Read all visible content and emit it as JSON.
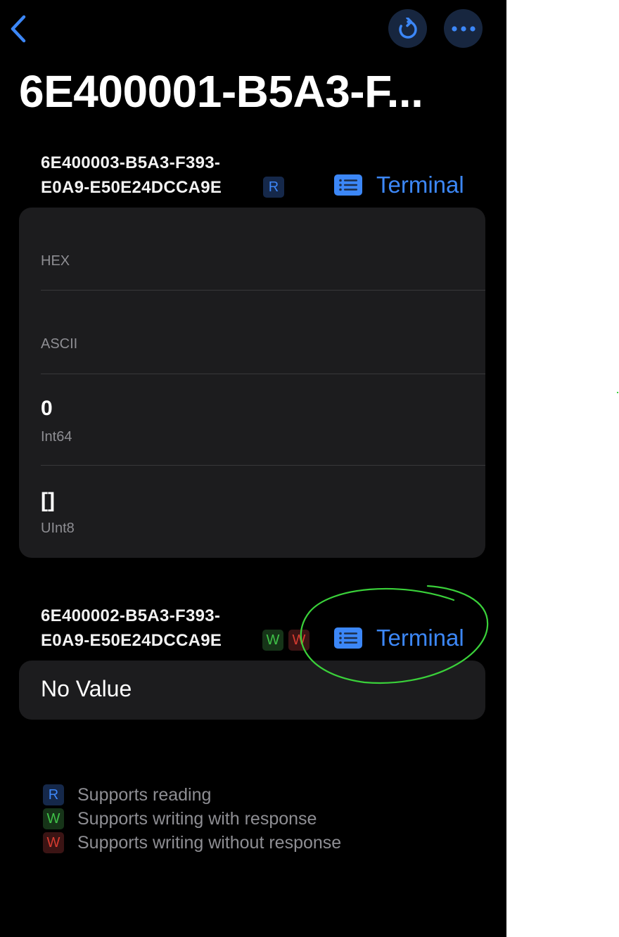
{
  "nav": {
    "back_icon": "chevron-left-icon",
    "refresh_icon": "refresh-icon",
    "more_icon": "ellipsis-icon",
    "accent": "#3c87f7"
  },
  "title": "6E400001-B5A3-F...",
  "characteristics": [
    {
      "uuid": "6E400003-B5A3-F393-\nE0A9-E50E24DCCA9E",
      "badges": [
        "R"
      ],
      "terminal_label": "Terminal",
      "rows": [
        {
          "label": "HEX",
          "value": ""
        },
        {
          "label": "ASCII",
          "value": ""
        },
        {
          "label": "Int64",
          "value": "0"
        },
        {
          "label": "UInt8",
          "value": "[]"
        }
      ]
    },
    {
      "uuid": "6E400002-B5A3-F393-\nE0A9-E50E24DCCA9E",
      "badges": [
        "W",
        "W"
      ],
      "terminal_label": "Terminal",
      "value_text": "No Value"
    }
  ],
  "legend": [
    {
      "badge": "R",
      "text": "Supports reading",
      "color": "#3d86f6"
    },
    {
      "badge": "W",
      "text": "Supports writing with response",
      "color": "#3fc148"
    },
    {
      "badge": "W",
      "text": "Supports writing without response",
      "color": "#d73b30"
    }
  ],
  "annotation": {
    "shape": "hand-drawn-ellipse",
    "color": "#3ad13a"
  }
}
